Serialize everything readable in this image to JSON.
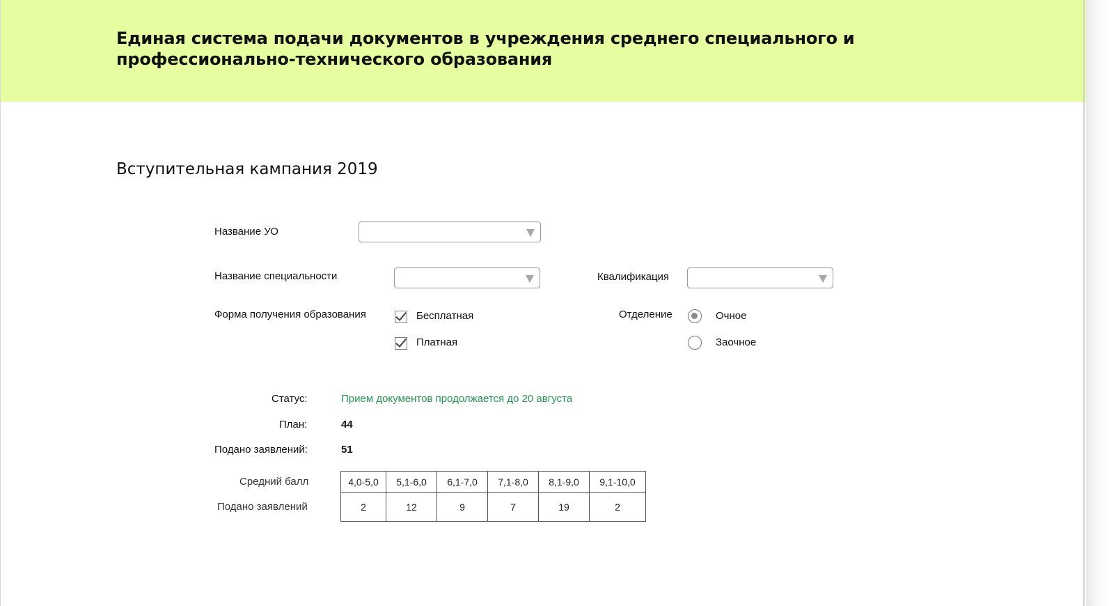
{
  "header": {
    "title": "Единая система подачи документов в учреждения среднего специального и профессионально-технического образования",
    "background": "#e6fea0"
  },
  "page_title": "Вступительная кампания 2019",
  "form": {
    "institution_label": "Название УО",
    "institution_value": "",
    "specialty_label": "Название специальности",
    "specialty_value": "",
    "qualification_label": "Квалификация",
    "qualification_value": "",
    "education_form_label": "Форма получения образования",
    "education_form_options": [
      {
        "label": "Бесплатная",
        "checked": true
      },
      {
        "label": "Платная",
        "checked": true
      }
    ],
    "department_label": "Отделение",
    "department_options": [
      {
        "label": "Очное",
        "selected": true
      },
      {
        "label": "Заочное",
        "selected": false
      }
    ]
  },
  "summary": {
    "status_label": "Статус:",
    "status_value": "Прием документов продолжается до 20 августа",
    "status_color": "#1f9a4e",
    "plan_label": "План:",
    "plan_value": "44",
    "submitted_label": "Подано заявлений:",
    "submitted_value": "51"
  },
  "score_table": {
    "row_label_score": "Средний балл",
    "row_label_count": "Подано заявлений",
    "ranges": [
      "4,0-5,0",
      "5,1-6,0",
      "6,1-7,0",
      "7,1-8,0",
      "8,1-9,0",
      "9,1-10,0"
    ],
    "counts": [
      "2",
      "12",
      "9",
      "7",
      "19",
      "2"
    ]
  },
  "icons": {
    "select_arrow": "triangle-down-icon",
    "checkbox_checked": "checkmark-icon",
    "radio_selected": "radio-dot-icon"
  }
}
